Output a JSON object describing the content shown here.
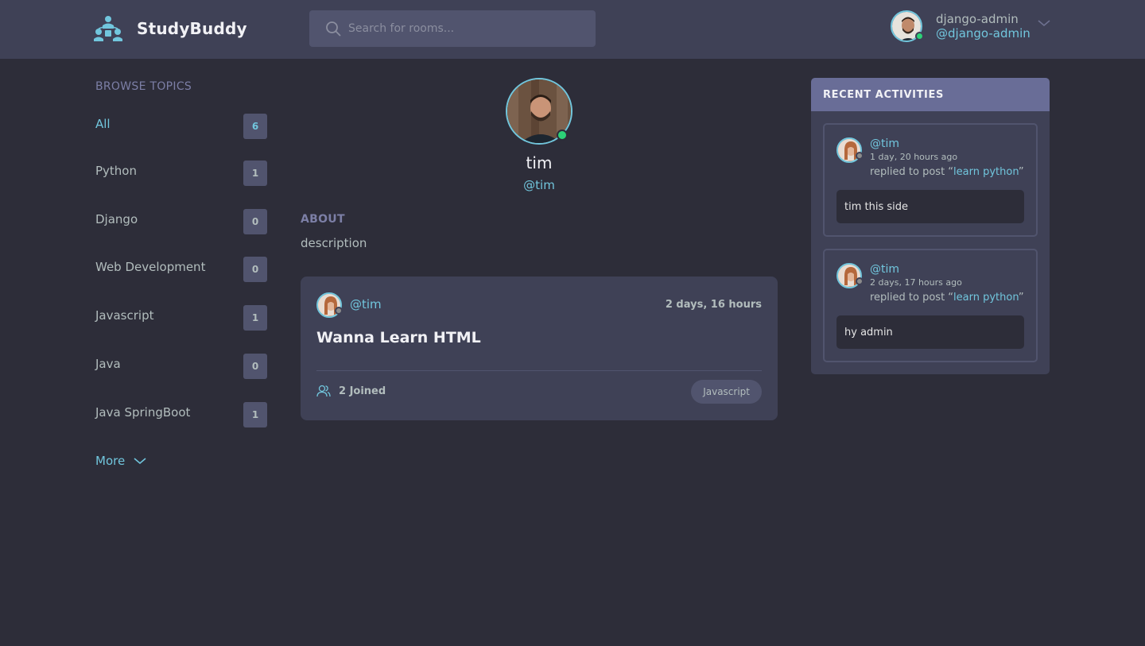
{
  "app": {
    "name": "StudyBuddy",
    "accent": "#71c6dd"
  },
  "search": {
    "placeholder": "Search for rooms..."
  },
  "current_user": {
    "name": "django-admin",
    "handle": "@django-admin"
  },
  "sidebar": {
    "title": "BROWSE TOPICS",
    "topics": [
      {
        "label": "All",
        "count": "6"
      },
      {
        "label": "Python",
        "count": "1"
      },
      {
        "label": "Django",
        "count": "0"
      },
      {
        "label": "Web Development",
        "count": "0"
      },
      {
        "label": "Javascript",
        "count": "1"
      },
      {
        "label": "Java",
        "count": "0"
      },
      {
        "label": "Java SpringBoot",
        "count": "1"
      }
    ],
    "more_label": "More"
  },
  "profile": {
    "name": "tim",
    "handle": "@tim",
    "about_title": "ABOUT",
    "about_text": "description"
  },
  "rooms": [
    {
      "host": "@tim",
      "time": "2 days, 16 hours",
      "title": "Wanna Learn HTML",
      "joined": "2 Joined",
      "topic": "Javascript"
    }
  ],
  "activities": {
    "title": "RECENT ACTIVITIES",
    "items": [
      {
        "user": "@tim",
        "time": "1 day, 20 hours ago",
        "action_prefix": "replied to post “",
        "post": "learn python",
        "action_suffix": "”",
        "message": "tim this side"
      },
      {
        "user": "@tim",
        "time": "2 days, 17 hours ago",
        "action_prefix": "replied to post “",
        "post": "learn python",
        "action_suffix": "”",
        "message": "hy admin"
      }
    ]
  }
}
